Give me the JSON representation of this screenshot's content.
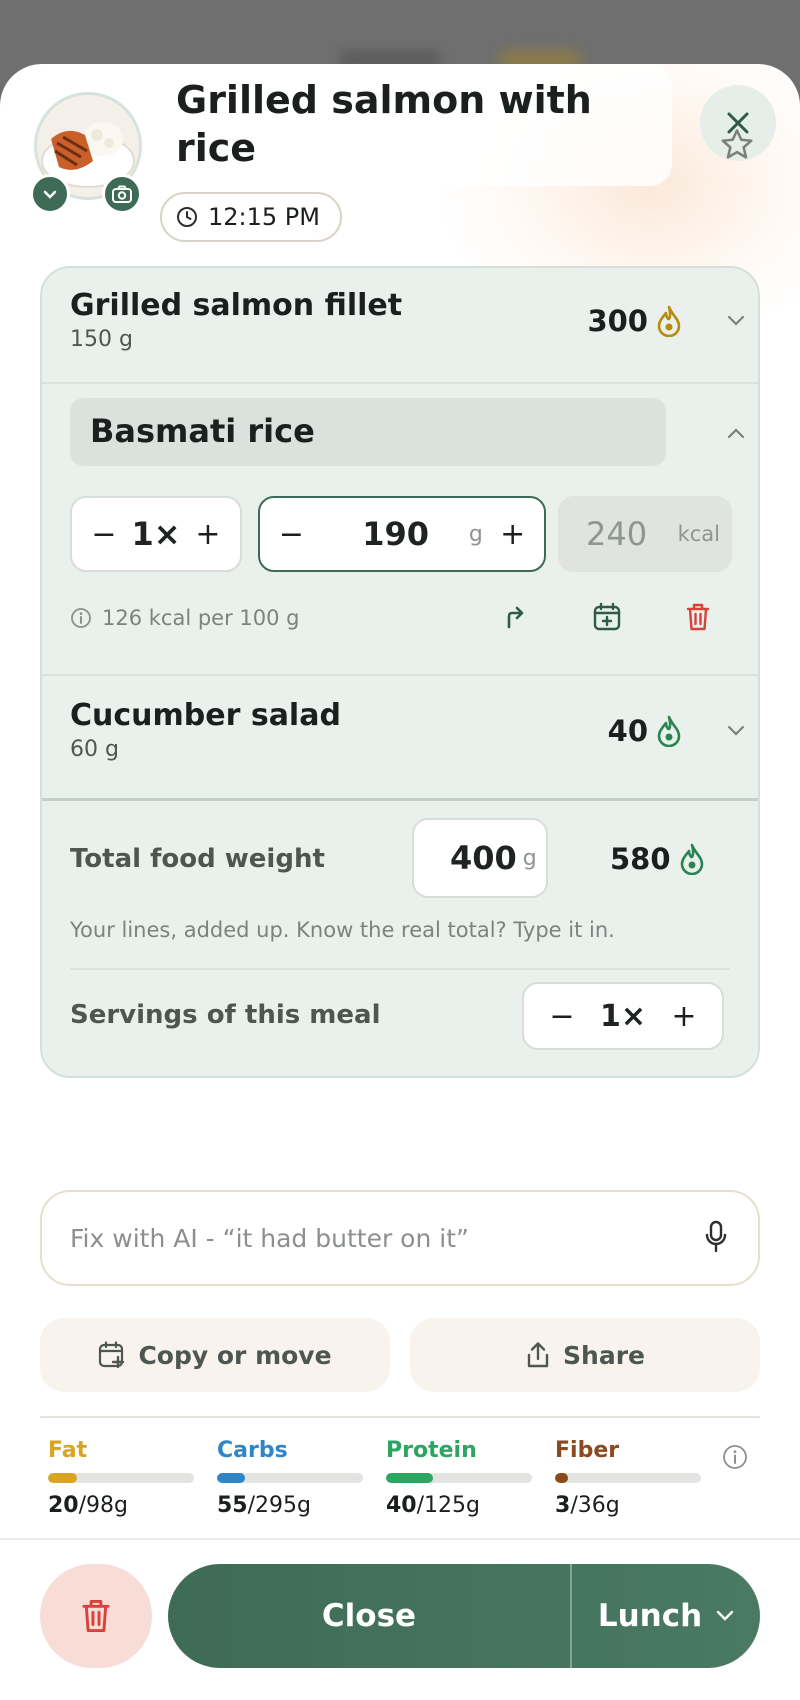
{
  "meal": {
    "title": "Grilled salmon with rice",
    "time": "12:15 PM"
  },
  "items": [
    {
      "name": "Grilled salmon fillet",
      "weight": "150 g",
      "kcal": "300"
    },
    {
      "name": "Basmati rice",
      "multiplier": "1×",
      "grams": "190",
      "grams_unit": "g",
      "kcal": "240",
      "kcal_unit": "kcal",
      "note": "126 kcal per 100 g"
    },
    {
      "name": "Cucumber salad",
      "weight": "60 g",
      "kcal": "40"
    }
  ],
  "totals": {
    "label": "Total food weight",
    "weight": "400",
    "weight_unit": "g",
    "kcal": "580",
    "hint": "Your lines, added up. Know the real total? Type it in.",
    "servings_label": "Servings of this meal",
    "servings": "1×"
  },
  "fix_ai": {
    "placeholder": "Fix with AI - “it had butter on it”"
  },
  "buttons": {
    "copy_move": "Copy or move",
    "share": "Share",
    "close": "Close",
    "meal_type": "Lunch"
  },
  "macros": [
    {
      "name": "Fat",
      "value": "20",
      "goal": "/98g",
      "fraction": 0.2,
      "color": "#d9a521"
    },
    {
      "name": "Carbs",
      "value": "55",
      "goal": "/295g",
      "fraction": 0.19,
      "color": "#2e86c9"
    },
    {
      "name": "Protein",
      "value": "40",
      "goal": "/125g",
      "fraction": 0.32,
      "color": "#2aa660"
    },
    {
      "name": "Fiber",
      "value": "3",
      "goal": "/36g",
      "fraction": 0.09,
      "color": "#8a4a1e"
    }
  ],
  "colors": {
    "brand": "#3f6b56",
    "danger": "#d9423a",
    "card": "#eaf1ed"
  }
}
